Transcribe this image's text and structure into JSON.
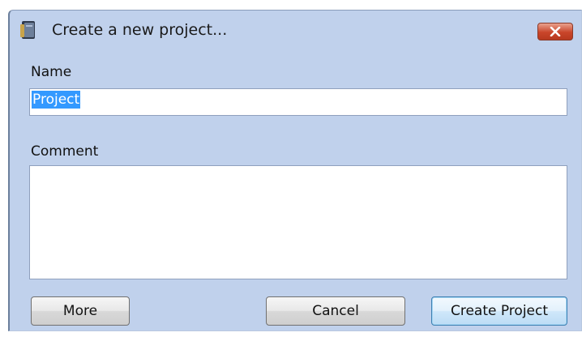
{
  "window": {
    "title": "Create a new project...",
    "icon": "app-book-icon",
    "close_icon": "close-icon"
  },
  "form": {
    "name_label": "Name",
    "name_value": "Project",
    "comment_label": "Comment",
    "comment_value": ""
  },
  "buttons": {
    "more": "More",
    "cancel": "Cancel",
    "create": "Create Project"
  },
  "colors": {
    "dialog_background": "#c0d1ec",
    "selection": "#3399ff",
    "close_button": "#c9452a",
    "default_button_border": "#3c7fb1"
  }
}
